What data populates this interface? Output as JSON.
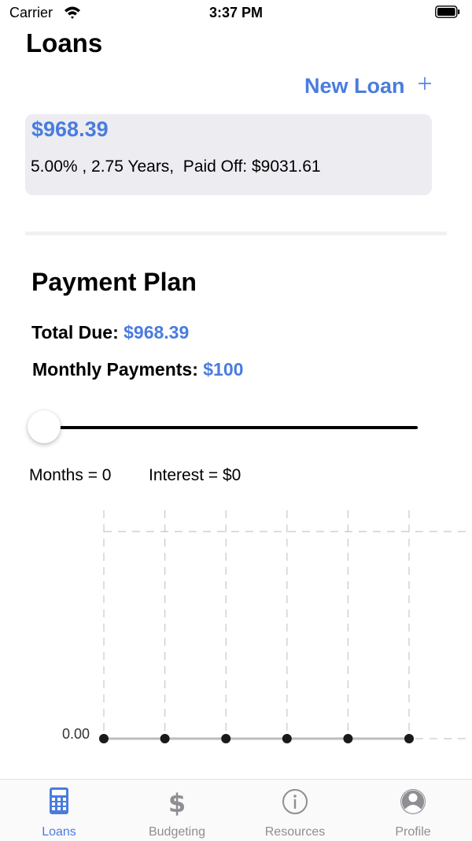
{
  "status_bar": {
    "carrier": "Carrier",
    "time": "3:37 PM"
  },
  "header": {
    "title": "Loans",
    "new_loan_label": "New Loan"
  },
  "loan_card": {
    "amount": "$968.39",
    "details": "5.00% , 2.75 Years,  Paid Off: $9031.61"
  },
  "payment_plan": {
    "title": "Payment Plan",
    "total_due_label": "Total Due:",
    "total_due_value": "$968.39",
    "monthly_label": "Monthly Payments:",
    "monthly_value": "$100",
    "slider_value_fraction": 0,
    "months_text": "Months = 0",
    "interest_text": "Interest = $0"
  },
  "chart_data": {
    "type": "line",
    "y_tick_labels": [
      "0.00"
    ],
    "series": [
      {
        "values": [
          0,
          0,
          0,
          0,
          0,
          0
        ]
      }
    ],
    "grid": true
  },
  "tab_bar": {
    "tabs": [
      {
        "label": "Loans",
        "icon": "calculator-icon",
        "active": true
      },
      {
        "label": "Budgeting",
        "icon": "dollar-icon",
        "active": false
      },
      {
        "label": "Resources",
        "icon": "info-icon",
        "active": false
      },
      {
        "label": "Profile",
        "icon": "profile-icon",
        "active": false
      }
    ]
  },
  "colors": {
    "accent": "#4a7cdf",
    "card_background": "#ececf1",
    "inactive_tab": "#8e8e93"
  }
}
